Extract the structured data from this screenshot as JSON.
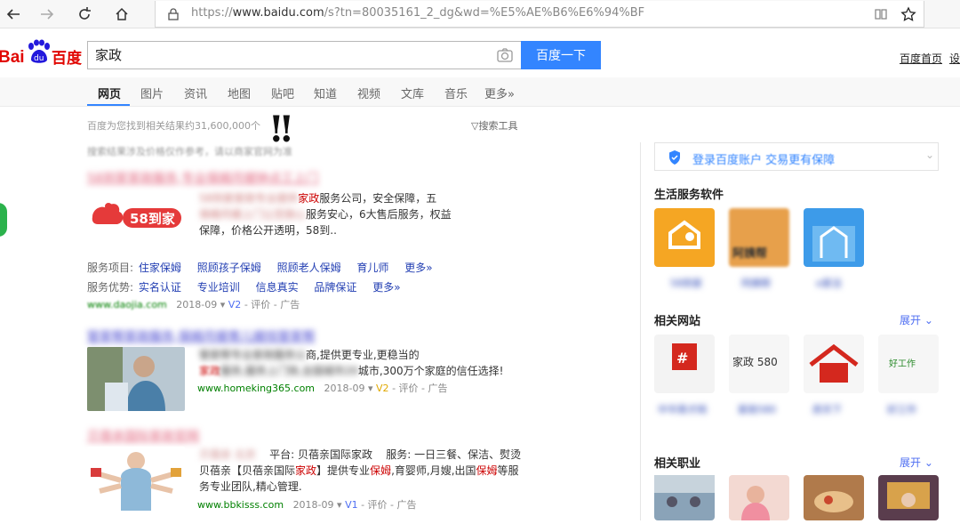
{
  "browser": {
    "url_prefix": "https://",
    "url_domain": "www.baidu.com",
    "url_rest": "/s?tn=80035161_2_dg&wd=%E5%AE%B6%E6%94%BF"
  },
  "header": {
    "query": "家政",
    "search_button": "百度一下",
    "home_link": "百度首页",
    "more_link": "设"
  },
  "tabs": [
    "网页",
    "图片",
    "资讯",
    "地图",
    "贴吧",
    "知道",
    "视频",
    "文库",
    "音乐",
    "更多»"
  ],
  "result_count": "百度为您找到相关结果约31,600,000个",
  "search_tools": "搜索工具",
  "exclaim": "!!",
  "notice": "搜索结果涉及价格仅作参考，请以商家官网为准",
  "results": [
    {
      "title": "58到家家政服务,专业保姆月嫂钟点工上门",
      "logo_text": "58到家",
      "desc_blur": "58到家家政专业提供",
      "desc_kw": "家政",
      "desc_1": "服务公司，安全保障，五",
      "desc_blur2": "保姆月嫂上门让您放心",
      "desc_2": "服务安心，6大售后服务，权益",
      "desc_3": "保障，价格公开透明，58到..",
      "svc_label": "服务项目:",
      "svc_items": [
        "住家保姆",
        "照顾孩子保姆",
        "照顾老人保姆",
        "育儿师",
        "更多»"
      ],
      "adv_label": "服务优势:",
      "adv_items": [
        "实名认证",
        "专业培训",
        "信息真实",
        "品牌保证",
        "更多»"
      ],
      "url": "www.daojia.com",
      "date": "2018-09",
      "badge": "V2",
      "tail": "- 评价 - 广告"
    },
    {
      "title": "管家帮家政服务,保姆月嫂育儿嫂找管家帮",
      "desc_blur": "管家帮专业家政服务公",
      "desc_1": "商,提供更专业,更稳当的",
      "desc_kw": "家政",
      "desc_blur2": "服务,服务上门快,全国城市20",
      "desc_2": "城市,300万个家庭的信任选择!",
      "url": "www.homeking365.com",
      "date": "2018-09",
      "badge": "V2",
      "tail": "- 评价 - 广告"
    },
    {
      "title": "贝蓓亲国际家政官网",
      "desc_blur": "贝蓓亲 北京",
      "desc_1": "平台: 贝蓓亲国际家政",
      "desc_1b": "服务: 一日三餐、保洁、熨烫",
      "desc_2a": "贝蓓亲【贝蓓亲国际",
      "desc_kw": "家政",
      "desc_2b": "】提供专业",
      "desc_kw2": "保姆",
      "desc_2c": ",育婴师,月嫂,出国",
      "desc_kw3": "保姆",
      "desc_2d": "等服",
      "desc_3": "务专业团队,精心管理.",
      "url": "www.bbkisss.com",
      "date": "2018-09",
      "badge": "V1",
      "tail": "- 评价 - 广告"
    }
  ],
  "sidebar": {
    "login_text": "登录百度账户 交易更有保障",
    "apps_title": "生活服务软件",
    "apps": [
      "58到家",
      "阿姨帮",
      "e家洁"
    ],
    "apps_icon_text": [
      "",
      "阿姨帮",
      ""
    ],
    "sites_title": "相关网站",
    "sites_expand": "展开",
    "sites": [
      "中华英才网",
      "家政580",
      "房天下",
      "好工作"
    ],
    "sites_logo_text": [
      "",
      "家政 580",
      "",
      "好工作"
    ],
    "jobs_title": "相关职业",
    "jobs_expand": "展开"
  },
  "colors": {
    "baidu_blue": "#3385ff",
    "link_blue": "#2440b3",
    "keyword_red": "#cc0000",
    "url_green": "#008000",
    "badge_blue": "#4e6ef2"
  }
}
